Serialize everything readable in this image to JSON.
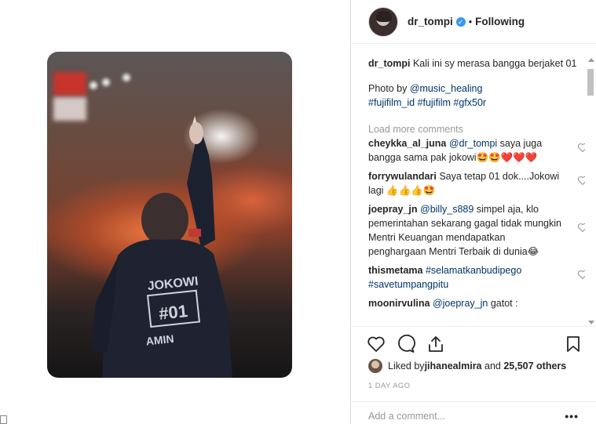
{
  "post": {
    "username": "dr_tompi",
    "follow_status": "Following",
    "bullet": "•"
  },
  "caption": {
    "username": "dr_tompi",
    "text": "Kali ini sy merasa bangga berjaket 01",
    "photo_by_prefix": "Photo by ",
    "photo_by_mention": "@music_healing",
    "hashtags": "#fujifilm_id #fujifilm #gfx50r"
  },
  "load_more": "Load more comments",
  "comments": [
    {
      "username": "cheykka_al_juna",
      "mention": "@dr_tompi",
      "text": " saya juga bangga sama pak jokowi🤩🤩❤️❤️❤️"
    },
    {
      "username": "forrywulandari",
      "mention": "",
      "text": "Saya tetap 01 dok....Jokowi lagi 👍👍👍🤩"
    },
    {
      "username": "joepray_jn",
      "mention": "@billy_s889",
      "text": " simpel aja, klo pemerintahan sekarang gagal tidak mungkin Mentri Keuangan mendapatkan penghargaan Mentri Terbaik di dunia😂"
    },
    {
      "username": "thismetama",
      "mention": "#selamatkanbudipego #savetumpangpitu",
      "text": ""
    },
    {
      "username": "moonirvulina",
      "mention": "@joepray_jn",
      "text": " gatot :"
    }
  ],
  "likes": {
    "prefix": "Liked by ",
    "first_user": "jihanealmira",
    "middle": " and ",
    "count": "25,507 others"
  },
  "timestamp": "1 DAY AGO",
  "add_comment_placeholder": "Add a comment...",
  "more_options": "•••",
  "colors": {
    "link": "#003569",
    "verified": "#3897f0",
    "muted": "#999999",
    "border": "#efefef"
  }
}
